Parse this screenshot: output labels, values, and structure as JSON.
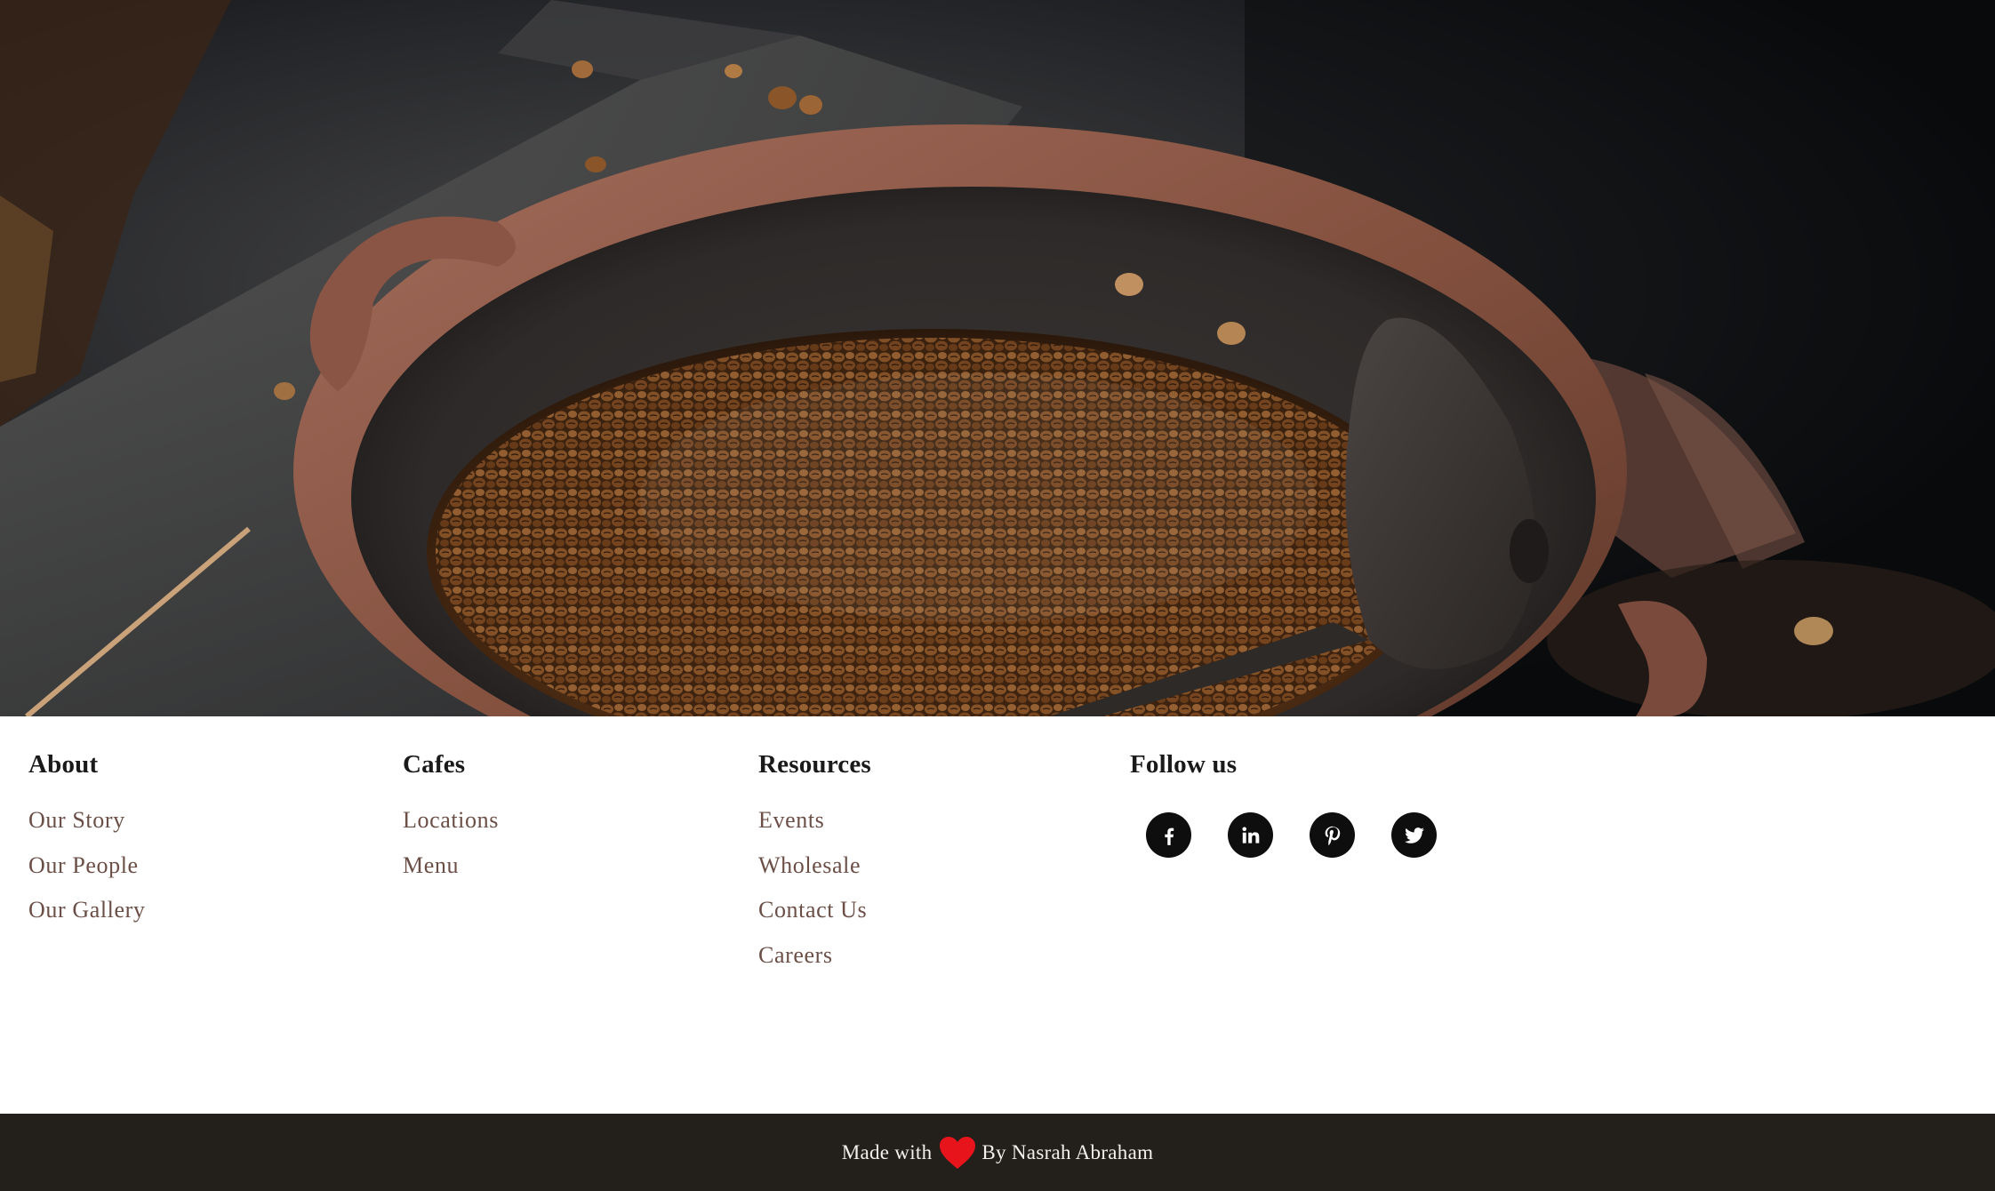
{
  "hero": {
    "image": "coffee-beans-in-clay-roasting-pan"
  },
  "footer": {
    "columns": [
      {
        "heading": "About",
        "links": [
          "Our Story",
          "Our People",
          "Our Gallery"
        ]
      },
      {
        "heading": "Cafes",
        "links": [
          "Locations",
          "Menu"
        ]
      },
      {
        "heading": "Resources",
        "links": [
          "Events",
          "Wholesale",
          "Contact Us",
          "Careers"
        ]
      }
    ],
    "follow": {
      "heading": "Follow us",
      "icons": [
        "facebook-icon",
        "linkedin-icon",
        "pinterest-icon",
        "twitter-icon"
      ]
    }
  },
  "bottom_bar": {
    "made_with": "Made with",
    "heart_icon": "heart-icon",
    "by": "By Nasrah Abraham",
    "heart_color": "#e8141c",
    "background": "#231f1a"
  },
  "colors": {
    "link": "#6b4f47",
    "heading": "#1a1a1a",
    "social_bg": "#0e0e0e"
  }
}
